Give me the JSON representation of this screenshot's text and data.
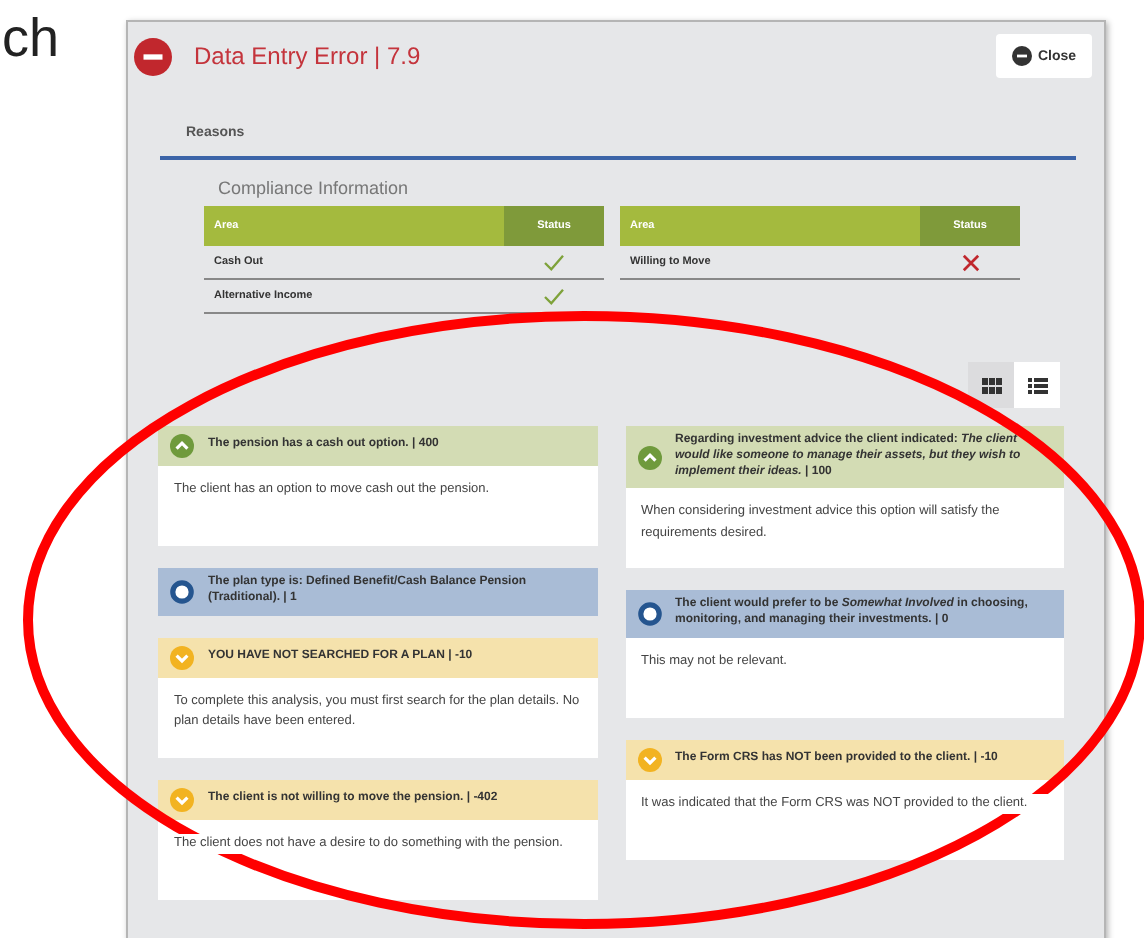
{
  "background_text": "ch",
  "window": {
    "title": "Data Entry Error | 7.9",
    "close_button": "Close"
  },
  "tabs": [
    {
      "label": "Reasons",
      "selected": true
    }
  ],
  "compliance": {
    "title": "Compliance Information",
    "tables": [
      {
        "columns": [
          "Area",
          "Status"
        ],
        "rows": [
          {
            "area": "Cash Out",
            "passed": true
          },
          {
            "area": "Alternative Income",
            "passed": true
          }
        ]
      },
      {
        "columns": [
          "Area",
          "Status"
        ],
        "rows": [
          {
            "area": "Willing to Move",
            "passed": false
          }
        ]
      }
    ]
  },
  "view_toggle": [
    {
      "kind": "grid",
      "selected": false
    },
    {
      "kind": "list",
      "selected": true
    }
  ],
  "columns": [
    [
      {
        "kind": "positive",
        "header": "The pension has a cash out option. | 400",
        "body": "The client has an option to move cash out the pension."
      },
      {
        "kind": "info",
        "header": "The plan type is: Defined Benefit/Cash Balance Pension (Traditional). | 1"
      },
      {
        "kind": "warning",
        "header": "YOU HAVE NOT SEARCHED FOR A PLAN | -10",
        "body": "To complete this analysis, you must first search for the plan details. No plan details have been entered."
      },
      {
        "kind": "warning",
        "header": "The client is not willing to move the pension. | -402",
        "body": "The client does not have a desire to do something with the pension."
      }
    ],
    [
      {
        "kind": "positive",
        "header": "Regarding investment advice the client indicated: *The client would like someone to manage their assets, but they wish to implement their ideas.* | 100",
        "body": "When considering investment advice this option will satisfy the requirements desired."
      },
      {
        "kind": "info",
        "header": "The client would prefer to be *Somewhat Involved* in choosing, monitoring, and managing their investments. | 0",
        "body": "This may not be relevant."
      },
      {
        "kind": "warning",
        "header": "The Form CRS has NOT been provided to the client. | -10",
        "body": "It was indicated that the Form CRS was NOT provided to the client."
      }
    ]
  ],
  "annotation": {
    "kind": "ellipse"
  }
}
